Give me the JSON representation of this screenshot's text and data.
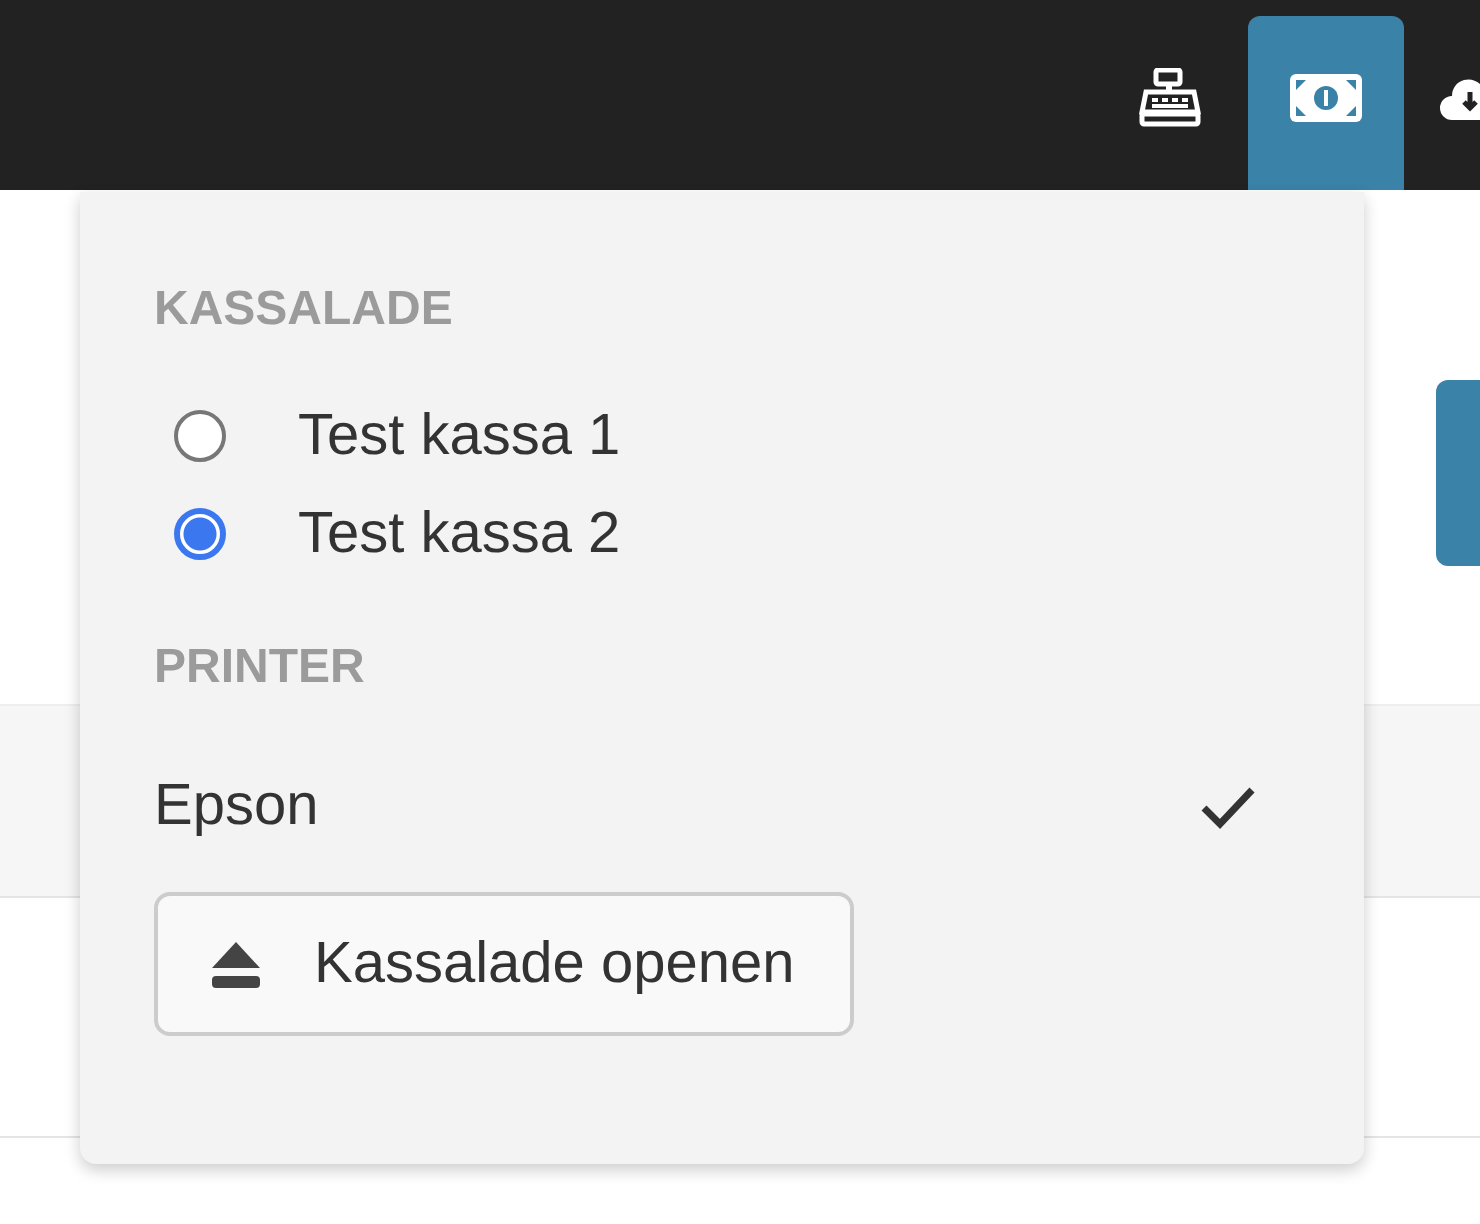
{
  "toolbar": {
    "icons": [
      {
        "kind": "register",
        "selected": false
      },
      {
        "kind": "money",
        "selected": true
      },
      {
        "kind": "cloud",
        "selected": false
      }
    ]
  },
  "dropdown": {
    "drawer_heading": "KASSALADE",
    "drawers": [
      {
        "label": "Test kassa 1",
        "selected": false
      },
      {
        "label": "Test kassa 2",
        "selected": true
      }
    ],
    "printer_heading": "PRINTER",
    "printers": [
      {
        "label": "Epson",
        "checked": true
      }
    ],
    "open_button": "Kassalade openen"
  }
}
